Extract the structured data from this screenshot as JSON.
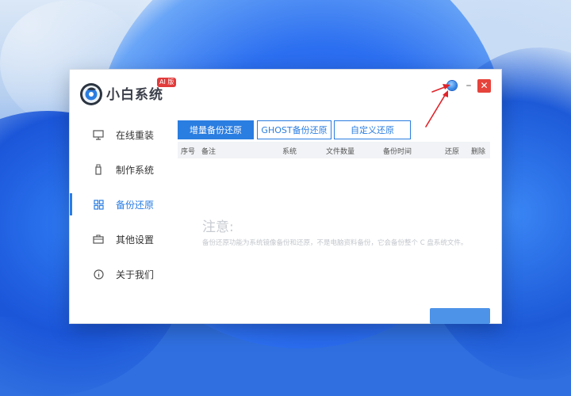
{
  "app": {
    "title": "小白系统",
    "badge": "AI 版"
  },
  "window_controls": {
    "minimize_glyph": "–",
    "close_glyph": "✕"
  },
  "sidebar": {
    "items": [
      {
        "label": "在线重装",
        "icon": "monitor-icon"
      },
      {
        "label": "制作系统",
        "icon": "usb-icon"
      },
      {
        "label": "备份还原",
        "icon": "grid-icon",
        "active": true
      },
      {
        "label": "其他设置",
        "icon": "toolbox-icon"
      },
      {
        "label": "关于我们",
        "icon": "info-icon"
      }
    ]
  },
  "tabs": [
    {
      "label": "增量备份还原",
      "active": true
    },
    {
      "label": "GHOST备份还原"
    },
    {
      "label": "自定义还原"
    }
  ],
  "table": {
    "columns": [
      "序号",
      "备注",
      "系统",
      "文件数量",
      "备份时间",
      "还原",
      "删除"
    ]
  },
  "note": {
    "title": "注意:",
    "text": "备份还原功能为系统镜像备份和还原，不是电脑资料备份，它会备份整个 C 盘系统文件。"
  },
  "colors": {
    "accent": "#2a7de1",
    "close": "#e5433b",
    "badge": "#e23b3b",
    "annotation_arrow": "#e0242a"
  }
}
